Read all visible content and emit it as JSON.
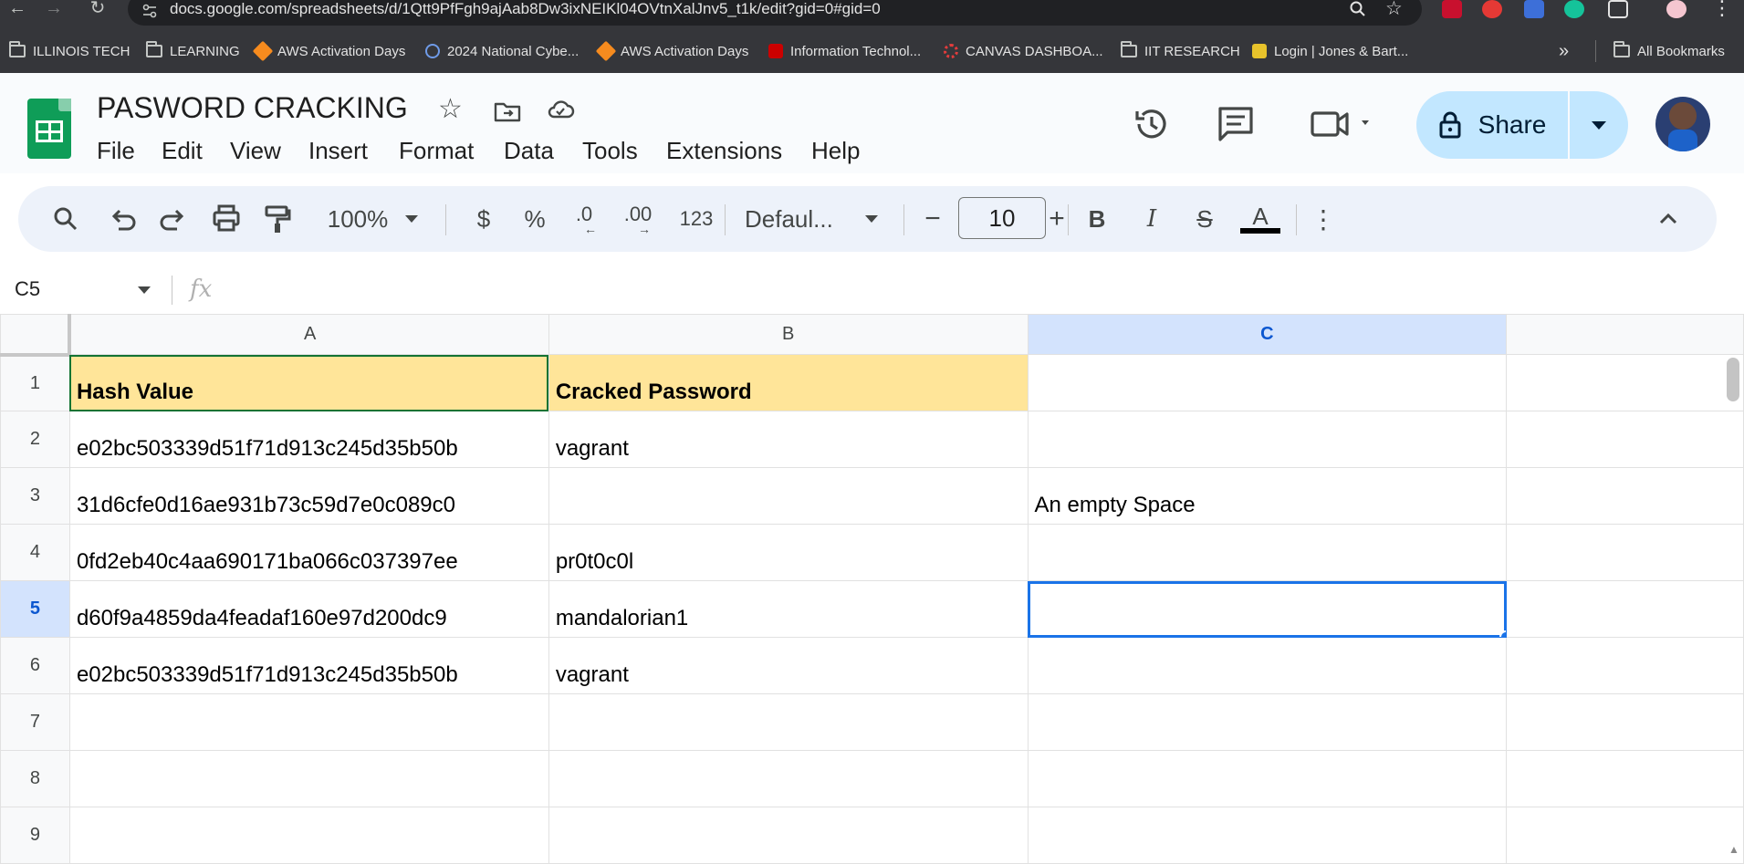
{
  "browser": {
    "url": "docs.google.com/spreadsheets/d/1Qtt9PfFgh9ajAab8Dw3ixNEIKl04OVtnXalJnv5_t1k/edit?gid=0#gid=0",
    "bookmarks": [
      {
        "label": "ILLINOIS TECH",
        "icon": "folder-icon"
      },
      {
        "label": "LEARNING",
        "icon": "folder-icon"
      },
      {
        "label": "AWS Activation Days",
        "icon": "aws-icon"
      },
      {
        "label": "2024 National Cybe...",
        "icon": "globe-icon"
      },
      {
        "label": "AWS Activation Days",
        "icon": "aws-icon"
      },
      {
        "label": "Information Technol...",
        "icon": "iit-icon"
      },
      {
        "label": "CANVAS DASHBOA...",
        "icon": "canvas-icon"
      },
      {
        "label": "IIT RESEARCH",
        "icon": "folder-icon"
      },
      {
        "label": "Login | Jones & Bart...",
        "icon": "jb-icon"
      }
    ],
    "all_bookmarks": "All Bookmarks",
    "overflow": "»"
  },
  "doc": {
    "title": "PASWORD CRACKING",
    "menu": [
      "File",
      "Edit",
      "View",
      "Insert",
      "Format",
      "Data",
      "Tools",
      "Extensions",
      "Help"
    ],
    "share_label": "Share"
  },
  "toolbar": {
    "zoom": "100%",
    "currency": "$",
    "percent": "%",
    "dec_decrease": ".0",
    "dec_increase": ".00",
    "number_format": "123",
    "font": "Defaul...",
    "font_size": "10",
    "bold": "B",
    "italic": "I",
    "strike": "S",
    "text_color_label": "A",
    "text_color": "#000000"
  },
  "formula_bar": {
    "name_box": "C5",
    "fx": "fx",
    "content": ""
  },
  "grid": {
    "columns": [
      "A",
      "B",
      "C",
      ""
    ],
    "selected_column": "C",
    "active_cell": "C5",
    "header_fill": "#ffe599",
    "rows": [
      {
        "num": "1",
        "cells": [
          "Hash Value",
          "Cracked Password",
          "",
          ""
        ]
      },
      {
        "num": "2",
        "cells": [
          "e02bc503339d51f71d913c245d35b50b",
          "vagrant",
          "",
          ""
        ]
      },
      {
        "num": "3",
        "cells": [
          "31d6cfe0d16ae931b73c59d7e0c089c0",
          "",
          "An empty Space",
          ""
        ]
      },
      {
        "num": "4",
        "cells": [
          "0fd2eb40c4aa690171ba066c037397ee",
          "pr0t0c0l",
          "",
          ""
        ]
      },
      {
        "num": "5",
        "cells": [
          "d60f9a4859da4feadaf160e97d200dc9",
          "mandalorian1",
          "",
          ""
        ]
      },
      {
        "num": "6",
        "cells": [
          "e02bc503339d51f71d913c245d35b50b",
          "vagrant",
          "",
          ""
        ]
      },
      {
        "num": "7",
        "cells": [
          "",
          "",
          "",
          ""
        ]
      },
      {
        "num": "8",
        "cells": [
          "",
          "",
          "",
          ""
        ]
      },
      {
        "num": "9",
        "cells": [
          "",
          "",
          "",
          ""
        ]
      }
    ]
  }
}
